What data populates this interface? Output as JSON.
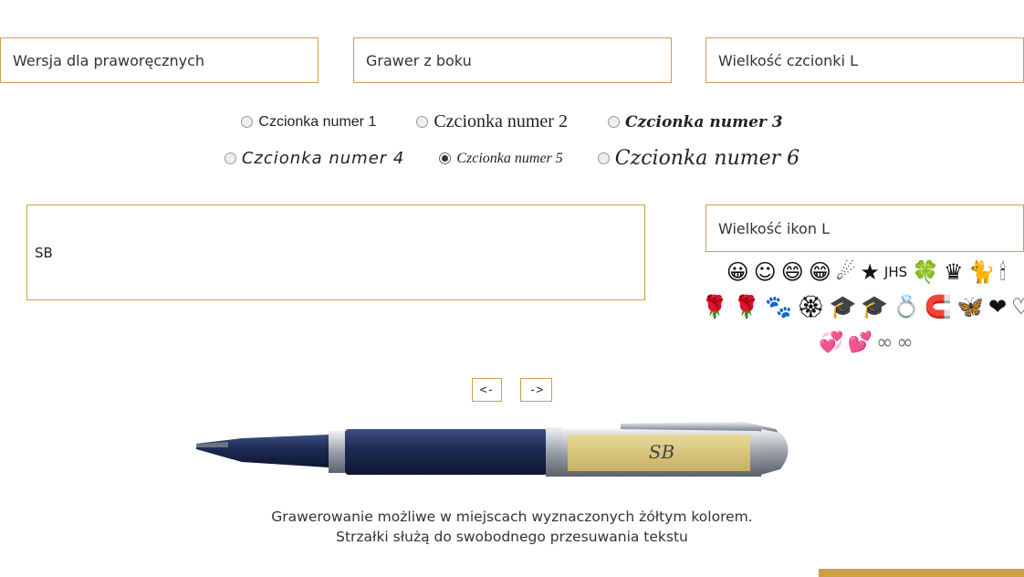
{
  "selects": {
    "hand": "Wersja dla praworęcznych",
    "engraving": "Grawer z boku",
    "font_size": "Wielkość czcionki L"
  },
  "fonts": {
    "options": [
      "Czcionka numer 1",
      "Czcionka numer 2",
      "Czcionka numer 3",
      "Czcionka numer 4",
      "Czcionka numer 5",
      "Czcionka numer 6"
    ],
    "selected": "Czcionka numer 5"
  },
  "text_input": {
    "value": "SB"
  },
  "icons": {
    "size_label": "Wielkość ikon L",
    "row1": [
      "😀",
      "☺",
      "😄",
      "😁",
      "☄",
      "★",
      "JHS",
      "🍀",
      "♛",
      "🐈",
      "🕯"
    ],
    "row2": [
      "🌹",
      "🌹",
      "🐾",
      "🏵",
      "🎓",
      "🎓",
      "💍",
      "🧲",
      "🦋",
      "❤",
      "♡"
    ],
    "row3": [
      "💞",
      "💕",
      "∞",
      "∞"
    ]
  },
  "controls": {
    "left_arrow": "<-",
    "right_arrow": "->"
  },
  "pen": {
    "engraving_preview": "SB",
    "colors": {
      "barrel": "#1c2a52",
      "cap_metal": "#b8bcc4",
      "engrave_area": "#d8c57c"
    }
  },
  "captions": {
    "line1": "Grawerowanie możliwe w miejscach wyznaczonych żółtym kolorem.",
    "line2": "Strzałki służą do swobodnego przesuwania tekstu"
  },
  "colors": {
    "accent": "#c9a14a"
  }
}
